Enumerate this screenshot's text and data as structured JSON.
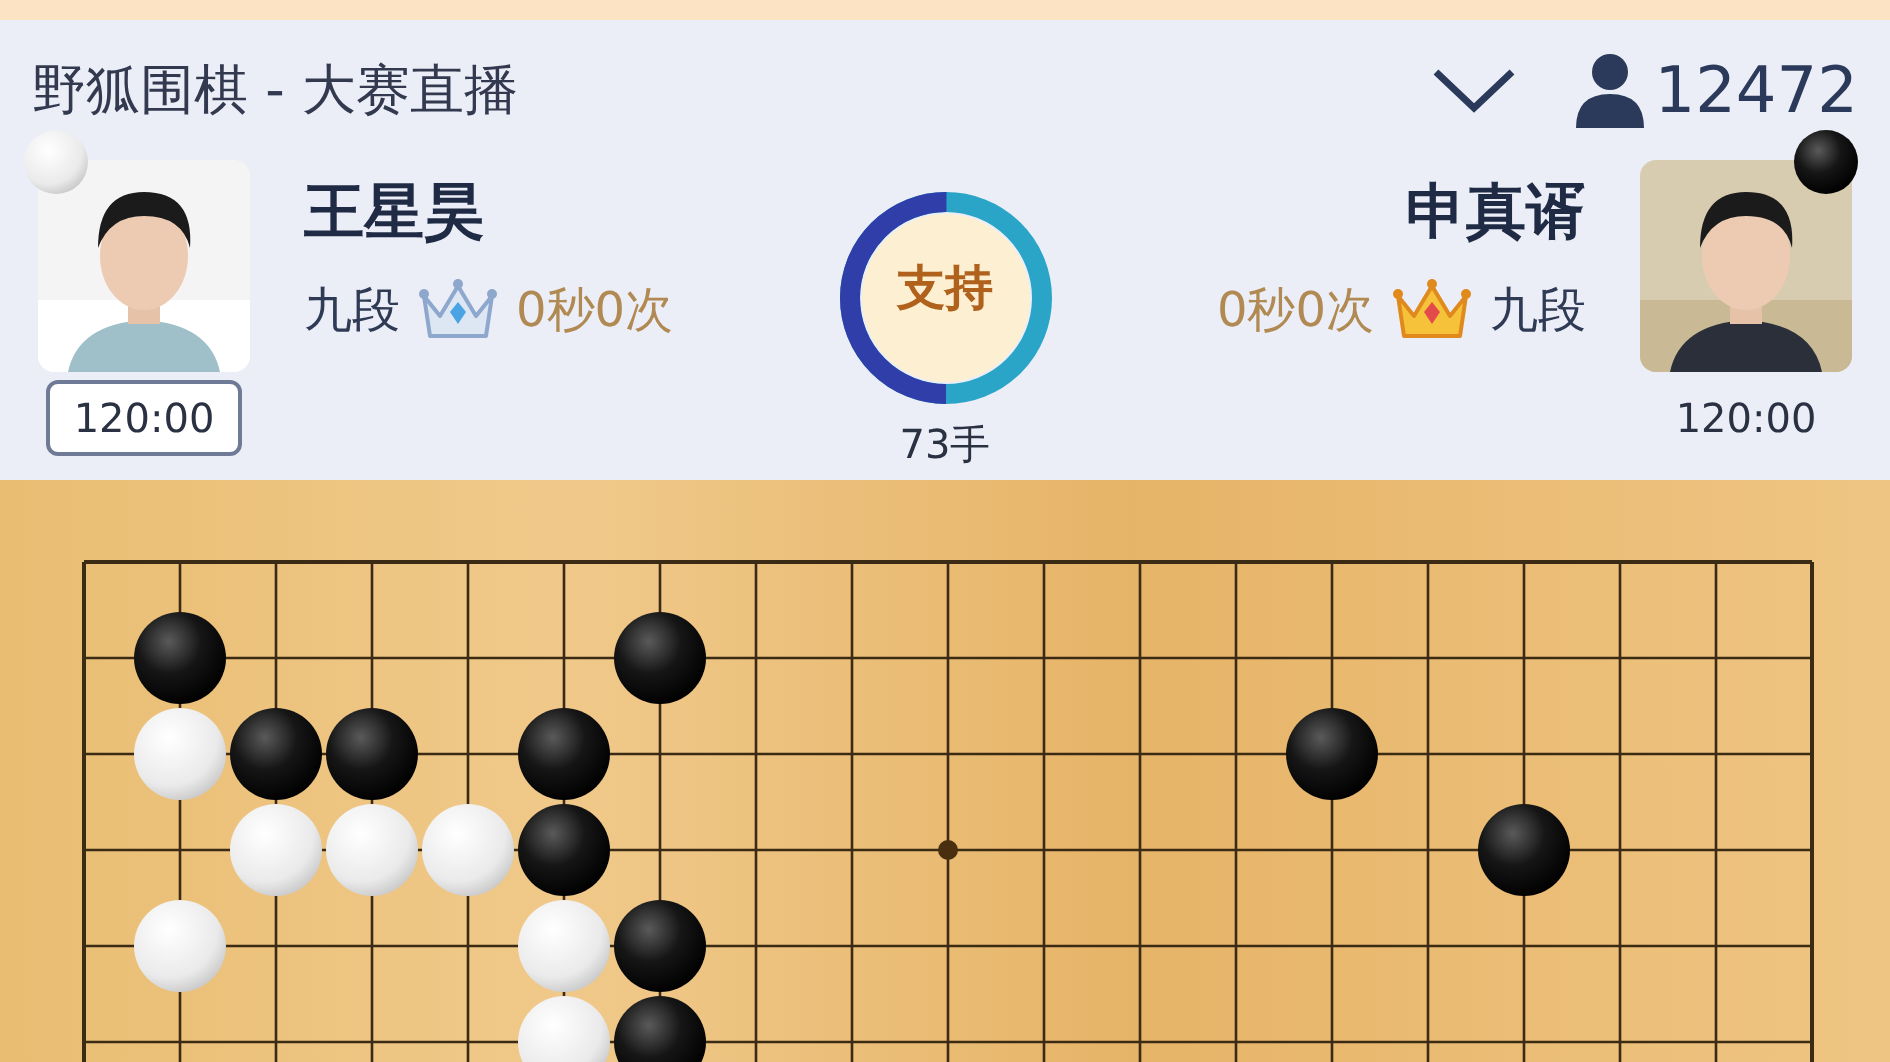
{
  "header": {
    "title": "野狐围棋 - 大赛直播",
    "viewers": "12472"
  },
  "players": [
    {
      "kind": "white",
      "name": "王星昊",
      "rank": "九段",
      "gold_crown": false,
      "byoyomi": "0秒0次",
      "clock": "120:00",
      "to_move": true
    },
    {
      "kind": "black",
      "name": "申真谞",
      "rank": "九段",
      "gold_crown": true,
      "byoyomi": "0秒0次",
      "clock": "120:00",
      "to_move": false
    }
  ],
  "support": {
    "label": "支持",
    "level": 0.5
  },
  "moves": "73手",
  "board": {
    "lines": [
      {
        "points": [
          {
            "kind": "empty"
          },
          {
            "kind": "empty"
          },
          {
            "kind": "empty"
          },
          {
            "kind": "empty"
          },
          {
            "kind": "empty"
          },
          {
            "kind": "empty"
          },
          {
            "kind": "empty"
          },
          {
            "kind": "empty"
          },
          {
            "kind": "empty"
          },
          {
            "kind": "empty"
          },
          {
            "kind": "empty"
          },
          {
            "kind": "empty"
          },
          {
            "kind": "empty"
          },
          {
            "kind": "empty"
          },
          {
            "kind": "empty"
          },
          {
            "kind": "empty"
          },
          {
            "kind": "empty"
          },
          {
            "kind": "empty"
          },
          {
            "kind": "empty"
          }
        ]
      },
      {
        "points": [
          {
            "kind": "empty"
          },
          {
            "kind": "black"
          },
          {
            "kind": "empty"
          },
          {
            "kind": "empty"
          },
          {
            "kind": "empty"
          },
          {
            "kind": "empty"
          },
          {
            "kind": "black"
          },
          {
            "kind": "empty"
          },
          {
            "kind": "empty"
          },
          {
            "kind": "empty"
          },
          {
            "kind": "empty"
          },
          {
            "kind": "empty"
          },
          {
            "kind": "empty"
          },
          {
            "kind": "empty"
          },
          {
            "kind": "empty"
          },
          {
            "kind": "empty"
          },
          {
            "kind": "empty"
          },
          {
            "kind": "empty"
          },
          {
            "kind": "empty"
          }
        ]
      },
      {
        "points": [
          {
            "kind": "empty"
          },
          {
            "kind": "white"
          },
          {
            "kind": "black"
          },
          {
            "kind": "black"
          },
          {
            "kind": "empty"
          },
          {
            "kind": "black"
          },
          {
            "kind": "empty"
          },
          {
            "kind": "empty"
          },
          {
            "kind": "empty"
          },
          {
            "kind": "empty"
          },
          {
            "kind": "empty"
          },
          {
            "kind": "empty"
          },
          {
            "kind": "empty"
          },
          {
            "kind": "black"
          },
          {
            "kind": "empty"
          },
          {
            "kind": "empty"
          },
          {
            "kind": "empty"
          },
          {
            "kind": "empty"
          },
          {
            "kind": "empty"
          }
        ]
      },
      {
        "points": [
          {
            "kind": "empty"
          },
          {
            "kind": "empty"
          },
          {
            "kind": "white"
          },
          {
            "kind": "white"
          },
          {
            "kind": "white"
          },
          {
            "kind": "black"
          },
          {
            "kind": "empty"
          },
          {
            "kind": "empty"
          },
          {
            "kind": "empty"
          },
          {
            "kind": "empty"
          },
          {
            "kind": "empty"
          },
          {
            "kind": "empty"
          },
          {
            "kind": "empty"
          },
          {
            "kind": "empty"
          },
          {
            "kind": "empty"
          },
          {
            "kind": "black"
          },
          {
            "kind": "empty"
          },
          {
            "kind": "empty"
          },
          {
            "kind": "empty"
          }
        ]
      },
      {
        "points": [
          {
            "kind": "empty"
          },
          {
            "kind": "white"
          },
          {
            "kind": "empty"
          },
          {
            "kind": "empty"
          },
          {
            "kind": "empty"
          },
          {
            "kind": "white"
          },
          {
            "kind": "black"
          },
          {
            "kind": "empty"
          },
          {
            "kind": "empty"
          },
          {
            "kind": "empty"
          },
          {
            "kind": "empty"
          },
          {
            "kind": "empty"
          },
          {
            "kind": "empty"
          },
          {
            "kind": "empty"
          },
          {
            "kind": "empty"
          },
          {
            "kind": "empty"
          },
          {
            "kind": "empty"
          },
          {
            "kind": "empty"
          },
          {
            "kind": "empty"
          }
        ]
      },
      {
        "points": [
          {
            "kind": "empty"
          },
          {
            "kind": "empty"
          },
          {
            "kind": "empty"
          },
          {
            "kind": "empty"
          },
          {
            "kind": "empty"
          },
          {
            "kind": "white"
          },
          {
            "kind": "black"
          },
          {
            "kind": "empty"
          },
          {
            "kind": "empty"
          },
          {
            "kind": "empty"
          },
          {
            "kind": "empty"
          },
          {
            "kind": "empty"
          },
          {
            "kind": "empty"
          },
          {
            "kind": "empty"
          },
          {
            "kind": "empty"
          },
          {
            "kind": "empty"
          },
          {
            "kind": "empty"
          },
          {
            "kind": "empty"
          },
          {
            "kind": "empty"
          }
        ]
      }
    ]
  }
}
